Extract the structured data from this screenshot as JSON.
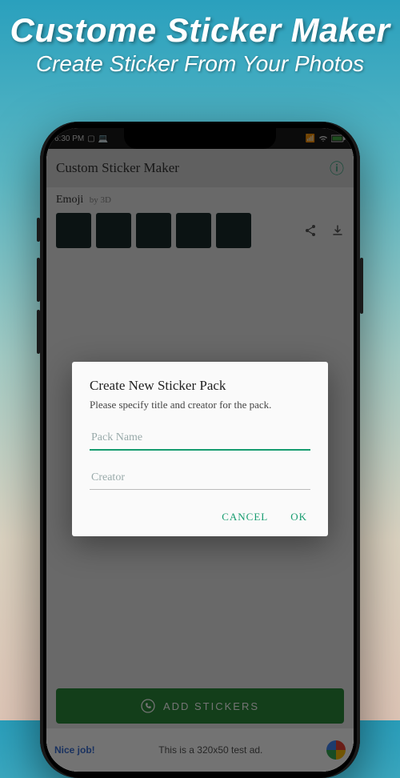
{
  "banner": {
    "title": "Custome Sticker Maker",
    "subtitle": "Create Sticker From Your Photos"
  },
  "statusbar": {
    "time": "6:30 PM"
  },
  "appbar": {
    "title": "Custom Sticker Maker"
  },
  "pack": {
    "name": "Emoji",
    "author_prefix": "by",
    "author": "3D"
  },
  "dialog": {
    "title": "Create New Sticker Pack",
    "subtitle": "Please specify title and creator for the pack.",
    "pack_placeholder": "Pack Name",
    "creator_placeholder": "Creator",
    "cancel": "CANCEL",
    "ok": "OK"
  },
  "add_button": "ADD STICKERS",
  "ad": {
    "nice": "Nice job!",
    "text": "This is a 320x50 test ad."
  }
}
